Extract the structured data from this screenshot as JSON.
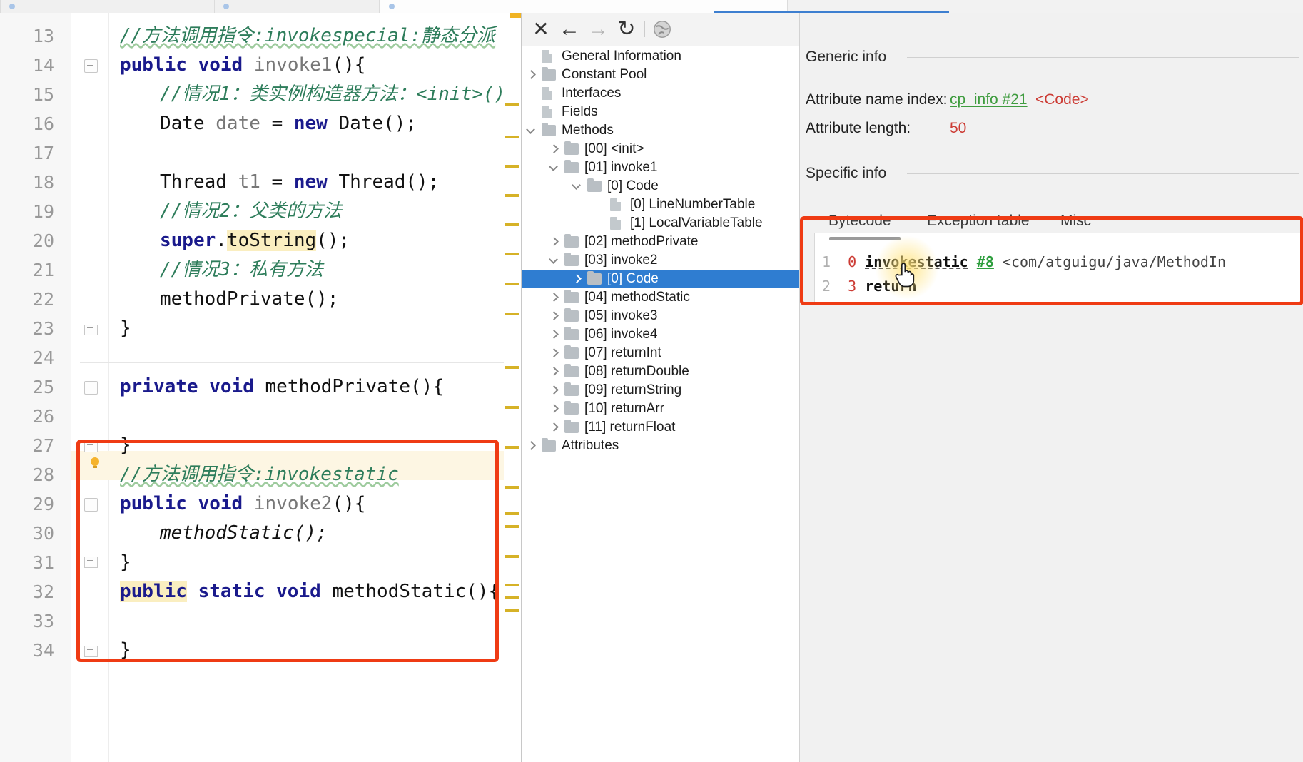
{
  "window": {
    "tabs": [
      "",
      "",
      ""
    ]
  },
  "editor": {
    "lines": [
      {
        "num": "13",
        "kind": "comment",
        "text": "//方法调用指令:invokespecial:静态分派"
      },
      {
        "num": "14",
        "kind": "code",
        "text": "public void invoke1(){"
      },
      {
        "num": "15",
        "kind": "comment",
        "text": "//情况1：类实例构造器方法：<init>()"
      },
      {
        "num": "16",
        "kind": "code",
        "text": "Date date = new Date();"
      },
      {
        "num": "17",
        "kind": "blank",
        "text": ""
      },
      {
        "num": "18",
        "kind": "code",
        "text": "Thread t1 = new Thread();"
      },
      {
        "num": "19",
        "kind": "comment",
        "text": "//情况2：父类的方法"
      },
      {
        "num": "20",
        "kind": "code",
        "text": "super.toString();"
      },
      {
        "num": "21",
        "kind": "comment",
        "text": "//情况3：私有方法"
      },
      {
        "num": "22",
        "kind": "code",
        "text": "methodPrivate();"
      },
      {
        "num": "23",
        "kind": "code",
        "text": "}"
      },
      {
        "num": "24",
        "kind": "blank",
        "text": ""
      },
      {
        "num": "25",
        "kind": "code",
        "text": "private void methodPrivate(){"
      },
      {
        "num": "26",
        "kind": "blank",
        "text": ""
      },
      {
        "num": "27",
        "kind": "code",
        "text": "}"
      },
      {
        "num": "28",
        "kind": "comment",
        "text": "//方法调用指令:invokestatic"
      },
      {
        "num": "29",
        "kind": "code",
        "text": "public void invoke2(){"
      },
      {
        "num": "30",
        "kind": "code",
        "text": "methodStatic();"
      },
      {
        "num": "31",
        "kind": "code",
        "text": "}"
      },
      {
        "num": "32",
        "kind": "code",
        "text": "public static void methodStatic(){"
      },
      {
        "num": "33",
        "kind": "blank",
        "text": ""
      },
      {
        "num": "34",
        "kind": "code",
        "text": "}"
      }
    ],
    "tokens": {
      "l13": "//方法调用指令:invokespecial:静态分派",
      "l14_k1": "public",
      "l14_k2": "void",
      "l14_id": "invoke1",
      "l14_p": "(){",
      "l15": "//情况1：类实例构造器方法：<init>()",
      "l16_t": "Date",
      "l16_v": "date",
      "l16_eq": "= ",
      "l16_new": "new",
      "l16_c": "Date();",
      "l18_t": "Thread",
      "l18_v": "t1",
      "l18_eq": "= ",
      "l18_new": "new",
      "l18_c": "Thread();",
      "l19": "//情况2：父类的方法",
      "l20_s": "super",
      "l20_dot": ".",
      "l20_m": "toString",
      "l20_p": "();",
      "l21": "//情况3：私有方法",
      "l22": "methodPrivate();",
      "l23": "}",
      "l25_k1": "private",
      "l25_k2": "void",
      "l25_m": "methodPrivate",
      "l25_p": "(){",
      "l27": "}",
      "l28": "//方法调用指令:invokestatic",
      "l29_k1": "public",
      "l29_k2": "void",
      "l29_id": "invoke2",
      "l29_p": "(){",
      "l30": "methodStatic();",
      "l31": "}",
      "l32_k1": "public",
      "l32_k2": "static",
      "l32_k3": "void",
      "l32_m": "methodStatic",
      "l32_p": "(){",
      "l34": "}"
    }
  },
  "toolbar": {
    "icons": [
      {
        "name": "close-icon",
        "glyph": "✕"
      },
      {
        "name": "back-arrow-icon",
        "glyph": "←"
      },
      {
        "name": "forward-arrow-icon",
        "glyph": "→"
      },
      {
        "name": "reload-icon",
        "glyph": "↻"
      },
      {
        "name": "browser-globe-icon",
        "glyph": "ἱ0"
      }
    ]
  },
  "tree": {
    "items": [
      {
        "label": "General Information",
        "indent": 0,
        "icon": "doc",
        "chevron": "none",
        "selected": false
      },
      {
        "label": "Constant Pool",
        "indent": 0,
        "icon": "folder",
        "chevron": "right",
        "selected": false
      },
      {
        "label": "Interfaces",
        "indent": 0,
        "icon": "doc",
        "chevron": "none",
        "selected": false
      },
      {
        "label": "Fields",
        "indent": 0,
        "icon": "doc",
        "chevron": "none",
        "selected": false
      },
      {
        "label": "Methods",
        "indent": 0,
        "icon": "folder",
        "chevron": "down",
        "selected": false
      },
      {
        "label": "[00] <init>",
        "indent": 1,
        "icon": "folder",
        "chevron": "right",
        "selected": false
      },
      {
        "label": "[01] invoke1",
        "indent": 1,
        "icon": "folder",
        "chevron": "down",
        "selected": false
      },
      {
        "label": "[0] Code",
        "indent": 2,
        "icon": "folder",
        "chevron": "down",
        "selected": false
      },
      {
        "label": "[0] LineNumberTable",
        "indent": 3,
        "icon": "doc",
        "chevron": "none",
        "selected": false
      },
      {
        "label": "[1] LocalVariableTable",
        "indent": 3,
        "icon": "doc",
        "chevron": "none",
        "selected": false
      },
      {
        "label": "[02] methodPrivate",
        "indent": 1,
        "icon": "folder",
        "chevron": "right",
        "selected": false
      },
      {
        "label": "[03] invoke2",
        "indent": 1,
        "icon": "folder",
        "chevron": "down",
        "selected": false
      },
      {
        "label": "[0] Code",
        "indent": 2,
        "icon": "folder",
        "chevron": "right",
        "selected": true
      },
      {
        "label": "[04] methodStatic",
        "indent": 1,
        "icon": "folder",
        "chevron": "right",
        "selected": false
      },
      {
        "label": "[05] invoke3",
        "indent": 1,
        "icon": "folder",
        "chevron": "right",
        "selected": false
      },
      {
        "label": "[06] invoke4",
        "indent": 1,
        "icon": "folder",
        "chevron": "right",
        "selected": false
      },
      {
        "label": "[07] returnInt",
        "indent": 1,
        "icon": "folder",
        "chevron": "right",
        "selected": false
      },
      {
        "label": "[08] returnDouble",
        "indent": 1,
        "icon": "folder",
        "chevron": "right",
        "selected": false
      },
      {
        "label": "[09] returnString",
        "indent": 1,
        "icon": "folder",
        "chevron": "right",
        "selected": false
      },
      {
        "label": "[10] returnArr",
        "indent": 1,
        "icon": "folder",
        "chevron": "right",
        "selected": false
      },
      {
        "label": "[11] returnFloat",
        "indent": 1,
        "icon": "folder",
        "chevron": "right",
        "selected": false
      },
      {
        "label": "Attributes",
        "indent": 0,
        "icon": "folder",
        "chevron": "right",
        "selected": false
      }
    ]
  },
  "detail": {
    "generic_info_heading": "Generic info",
    "attribute_name_index_label": "Attribute name index:",
    "attribute_name_index_link": "cp_info #21",
    "attribute_name_index_value": "<Code>",
    "attribute_length_label": "Attribute length:",
    "attribute_length_value": "50",
    "specific_info_heading": "Specific info",
    "tabs": [
      "Bytecode",
      "Exception table",
      "Misc"
    ],
    "active_tab": "Bytecode",
    "bytecode": [
      {
        "no": "1",
        "offset": "0",
        "op": "invokestatic",
        "ref": "#8",
        "arg": "<com/atguigu/java/MethodIn"
      },
      {
        "no": "2",
        "offset": "3",
        "op": "return",
        "ref": "",
        "arg": ""
      }
    ]
  },
  "colors": {
    "accent_red": "#ef3b14",
    "selection_blue": "#2f7dd1",
    "link_green": "#3f9c3f",
    "value_red": "#cc3b34",
    "marker_yellow": "#d6b227"
  }
}
